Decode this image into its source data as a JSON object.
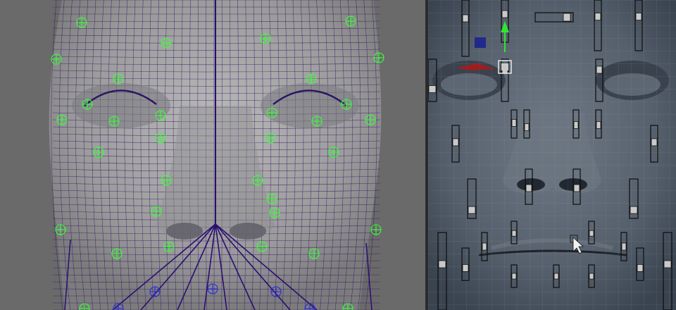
{
  "app": {
    "viewports": [
      {
        "id": "persp",
        "kind": "wireframe-face-rig"
      },
      {
        "id": "face-control-board",
        "kind": "shaded-face-with-slider-controls"
      }
    ]
  },
  "colors": {
    "viewport_bg": "#6a6a6a",
    "wireframe": "#30106a",
    "locator": "#3bff3b",
    "locator_blue": "#2a2ad8",
    "control_board_bg": "#2f343b",
    "move_manipulator": "#2ee62e",
    "selected_control": "#1f2a8c",
    "red_highlight": "#b01818"
  },
  "icons": [
    "move-arrow-icon",
    "mouse-cursor-icon",
    "selected-control-square-icon"
  ]
}
